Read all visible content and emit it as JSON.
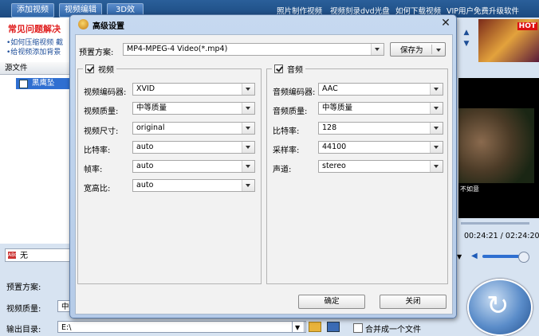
{
  "app": {
    "top_buttons": [
      "添加视频",
      "视频编辑",
      "3D效果"
    ],
    "top_links": [
      "照片制作视频",
      "视频刻录dvd光盘",
      "如何下载视频",
      "VIP用户免费升级软件"
    ],
    "faq": {
      "title": "常见问题解决",
      "lines": [
        "•如何压缩视频  截",
        "•给视频添加背景"
      ]
    },
    "source_header": "源文件",
    "file_item": "黑鹰坠",
    "subtitle_value": "无",
    "ad_hot": "HOT",
    "video_caption": "不如意",
    "time_display": "00:24:21 / 02:24:20",
    "bottom": {
      "preset_label": "预置方案:",
      "quality_label": "视频质量:",
      "quality_value": "中",
      "output_label": "输出目录:",
      "output_value": "E:\\",
      "merge_label": "合并成一个文件"
    }
  },
  "dialog": {
    "title": "高级设置",
    "preset_label": "预置方案:",
    "preset_value": "MP4-MPEG-4 Video(*.mp4)",
    "save_as": "保存为",
    "video": {
      "title": "视频",
      "checked": true,
      "fields": [
        {
          "label": "视频编码器:",
          "value": "XVID"
        },
        {
          "label": "视频质量:",
          "value": "中等质量"
        },
        {
          "label": "视频尺寸:",
          "value": "original"
        },
        {
          "label": "比特率:",
          "value": "auto"
        },
        {
          "label": "帧率:",
          "value": "auto"
        },
        {
          "label": "宽高比:",
          "value": "auto"
        }
      ]
    },
    "audio": {
      "title": "音频",
      "checked": true,
      "fields": [
        {
          "label": "音频编码器:",
          "value": "AAC"
        },
        {
          "label": "音频质量:",
          "value": "中等质量"
        },
        {
          "label": "比特率:",
          "value": "128"
        },
        {
          "label": "采样率:",
          "value": "44100"
        },
        {
          "label": "声道:",
          "value": "stereo"
        }
      ]
    },
    "ok": "确定",
    "close": "关闭"
  }
}
